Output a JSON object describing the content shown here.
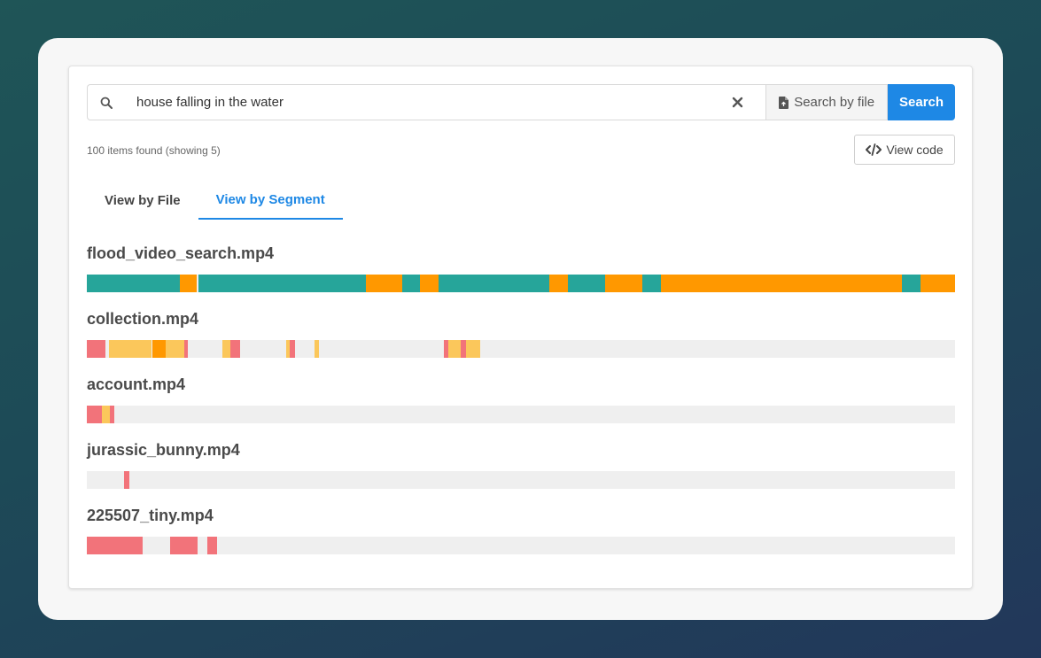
{
  "search": {
    "query": "house falling in the water",
    "search_by_file_label": "Search by file",
    "search_label": "Search"
  },
  "results": {
    "count_text": "100 items found (showing 5)",
    "view_code_label": "View code"
  },
  "tabs": [
    {
      "label": "View by File",
      "active": false
    },
    {
      "label": "View by Segment",
      "active": true
    }
  ],
  "colors": {
    "teal": "#26a59a",
    "orange": "#ff9800",
    "yellow": "#fbc75b",
    "red": "#f2737a",
    "track": "#efefef",
    "accent": "#1e88e5"
  },
  "files": [
    {
      "name": "flood_video_search.mp4",
      "segments": [
        {
          "start": 0,
          "end": 10.7,
          "color": "teal"
        },
        {
          "start": 10.7,
          "end": 12.7,
          "color": "orange"
        },
        {
          "start": 12.9,
          "end": 32.1,
          "color": "teal"
        },
        {
          "start": 32.1,
          "end": 36.3,
          "color": "orange"
        },
        {
          "start": 36.3,
          "end": 38.4,
          "color": "teal"
        },
        {
          "start": 38.4,
          "end": 40.5,
          "color": "orange"
        },
        {
          "start": 40.5,
          "end": 53.3,
          "color": "teal"
        },
        {
          "start": 53.3,
          "end": 55.4,
          "color": "orange"
        },
        {
          "start": 55.4,
          "end": 59.7,
          "color": "teal"
        },
        {
          "start": 59.7,
          "end": 64.0,
          "color": "orange"
        },
        {
          "start": 64.0,
          "end": 66.1,
          "color": "teal"
        },
        {
          "start": 66.1,
          "end": 93.9,
          "color": "orange"
        },
        {
          "start": 93.9,
          "end": 96.0,
          "color": "teal"
        },
        {
          "start": 96.0,
          "end": 100,
          "color": "orange"
        }
      ]
    },
    {
      "name": "collection.mp4",
      "segments": [
        {
          "start": 0,
          "end": 2.1,
          "color": "red"
        },
        {
          "start": 2.6,
          "end": 7.5,
          "color": "yellow"
        },
        {
          "start": 7.5,
          "end": 9.1,
          "color": "orange"
        },
        {
          "start": 9.1,
          "end": 11.2,
          "color": "yellow"
        },
        {
          "start": 11.2,
          "end": 11.6,
          "color": "red"
        },
        {
          "start": 15.6,
          "end": 16.5,
          "color": "yellow"
        },
        {
          "start": 16.5,
          "end": 17.7,
          "color": "red"
        },
        {
          "start": 23.0,
          "end": 23.4,
          "color": "yellow"
        },
        {
          "start": 23.4,
          "end": 24.0,
          "color": "red"
        },
        {
          "start": 26.2,
          "end": 26.7,
          "color": "yellow"
        },
        {
          "start": 41.1,
          "end": 41.6,
          "color": "red"
        },
        {
          "start": 41.6,
          "end": 43.1,
          "color": "yellow"
        },
        {
          "start": 43.1,
          "end": 43.7,
          "color": "red"
        },
        {
          "start": 43.7,
          "end": 45.3,
          "color": "yellow"
        }
      ]
    },
    {
      "name": "account.mp4",
      "segments": [
        {
          "start": 0,
          "end": 1.7,
          "color": "red"
        },
        {
          "start": 1.7,
          "end": 2.7,
          "color": "yellow"
        },
        {
          "start": 2.7,
          "end": 3.2,
          "color": "red"
        }
      ]
    },
    {
      "name": "jurassic_bunny.mp4",
      "segments": [
        {
          "start": 4.3,
          "end": 4.9,
          "color": "red"
        }
      ]
    },
    {
      "name": "225507_tiny.mp4",
      "segments": [
        {
          "start": 0,
          "end": 6.4,
          "color": "red"
        },
        {
          "start": 9.6,
          "end": 12.8,
          "color": "red"
        },
        {
          "start": 13.9,
          "end": 15.0,
          "color": "red"
        }
      ]
    }
  ]
}
